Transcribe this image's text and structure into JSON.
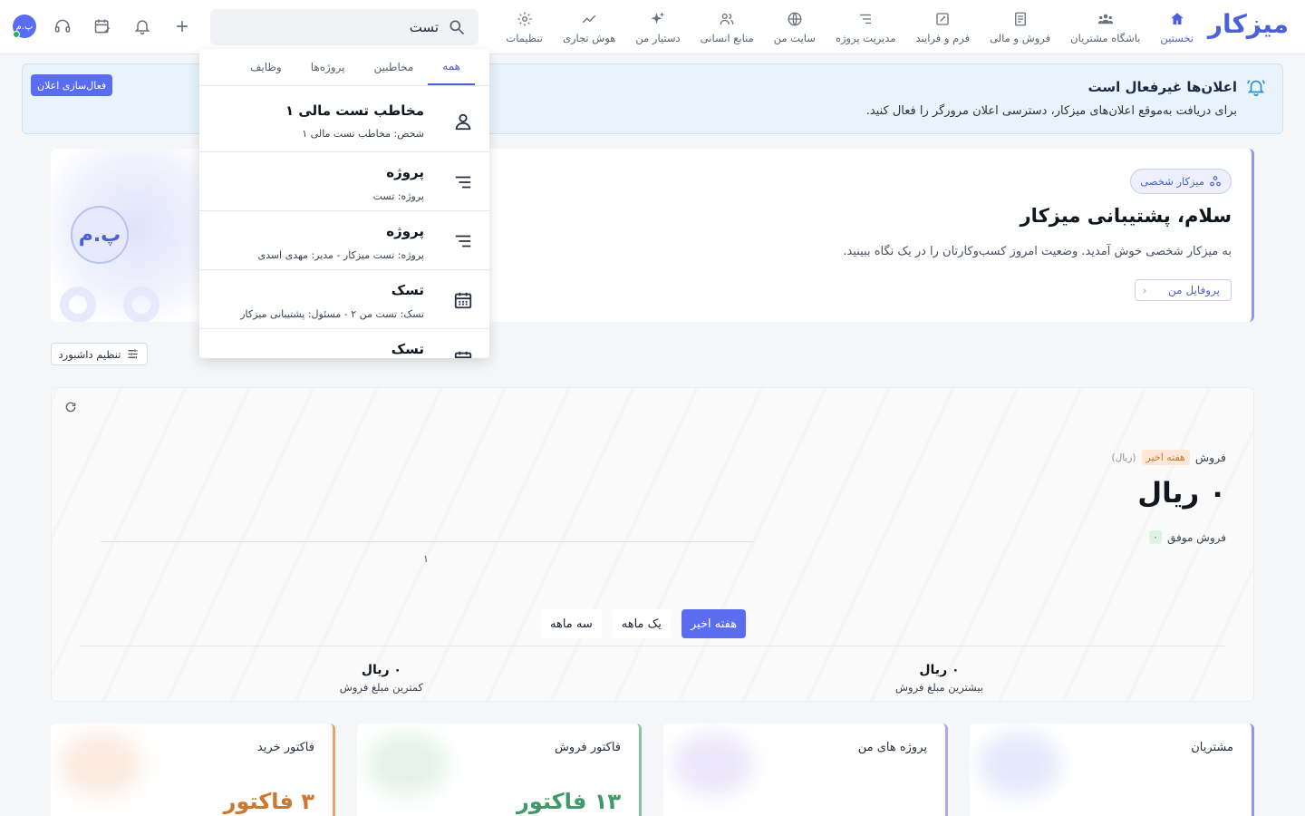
{
  "app": {
    "logo": "میزکار"
  },
  "nav": [
    {
      "label": "نخستین",
      "icon": "home-icon",
      "active": true
    },
    {
      "label": "باشگاه مشتریان",
      "icon": "users-icon"
    },
    {
      "label": "فروش و مالی",
      "icon": "receipt-icon"
    },
    {
      "label": "فرم و فرایند",
      "icon": "form-icon"
    },
    {
      "label": "مدیریت پروژه",
      "icon": "list-icon"
    },
    {
      "label": "سایت من",
      "icon": "globe-icon"
    },
    {
      "label": "منابع انسانی",
      "icon": "people-icon"
    },
    {
      "label": "دستیار من",
      "icon": "sparkle-icon"
    },
    {
      "label": "هوش تجاری",
      "icon": "chart-line-icon"
    },
    {
      "label": "تنظیمات",
      "icon": "gear-icon"
    }
  ],
  "search": {
    "value": "تست",
    "placeholder": ""
  },
  "user": {
    "initials": "پ.م"
  },
  "banner": {
    "title": "اعلان‌ها غیرفعال است",
    "text": "برای دریافت به‌موقع اعلان‌های میزکار، دسترسی اعلان مرورگر را فعال کنید.",
    "button": "فعال‌سازی اعلان"
  },
  "hero": {
    "tag": "میزکار شخصی",
    "title": "سلام، پشتیبانی میزکار",
    "text": "به میزکار شخصی خوش آمدید. وضعیت امروز کسب‌وکارتان را در یک نگاه ببینید.",
    "button": "پروفایل من",
    "avatar": "پ.م"
  },
  "dashboard_button": "تنظیم داشبورد",
  "sales": {
    "label": "فروش",
    "period_pill": "هفته اخیر",
    "unit": "(ریال)",
    "amount": "۰ ریال",
    "success_count": "۰",
    "success_label": "فروش موفق",
    "axis_tick": "۱",
    "periods": [
      {
        "label": "هفته اخیر",
        "active": true
      },
      {
        "label": "یک ماهه"
      },
      {
        "label": "سه ماهه"
      }
    ],
    "max": {
      "value": "۰ ریال",
      "label": "بیشترین مبلغ فروش"
    },
    "min": {
      "value": "۰ ریال",
      "label": "کمترین مبلغ فروش"
    }
  },
  "cards": [
    {
      "title": "مشتریان",
      "value": "",
      "color": "#8d96f0"
    },
    {
      "title": "پروژه های من",
      "value": "",
      "color": "#b3a6ee"
    },
    {
      "title": "فاکتور فروش",
      "value": "۱۳ فاکتور",
      "color": "#7fc7a0"
    },
    {
      "title": "فاکتور خرید",
      "value": "۳ فاکتور",
      "color": "#e7a36b"
    }
  ],
  "dropdown": {
    "tabs": [
      "همه",
      "مخاطبین",
      "پروژه‌ها",
      "وظایف"
    ],
    "results": [
      {
        "title": "مخاطب تست مالی ۱",
        "sub": "شخص: مخاطب تست مالی ۱",
        "icon": "person-icon"
      },
      {
        "title": "پروژه",
        "sub": "پروژه: تست",
        "icon": "list-icon"
      },
      {
        "title": "پروژه",
        "sub": "پروژه: تست میزکار - مدیر: مهدی اسدی",
        "icon": "list-icon"
      },
      {
        "title": "تسک",
        "sub": "تسک: تست من ۲ - مسئول: پشتیبانی میزکار",
        "icon": "calendar-icon"
      },
      {
        "title": "تسک",
        "sub": "",
        "icon": "calendar-icon"
      }
    ]
  }
}
